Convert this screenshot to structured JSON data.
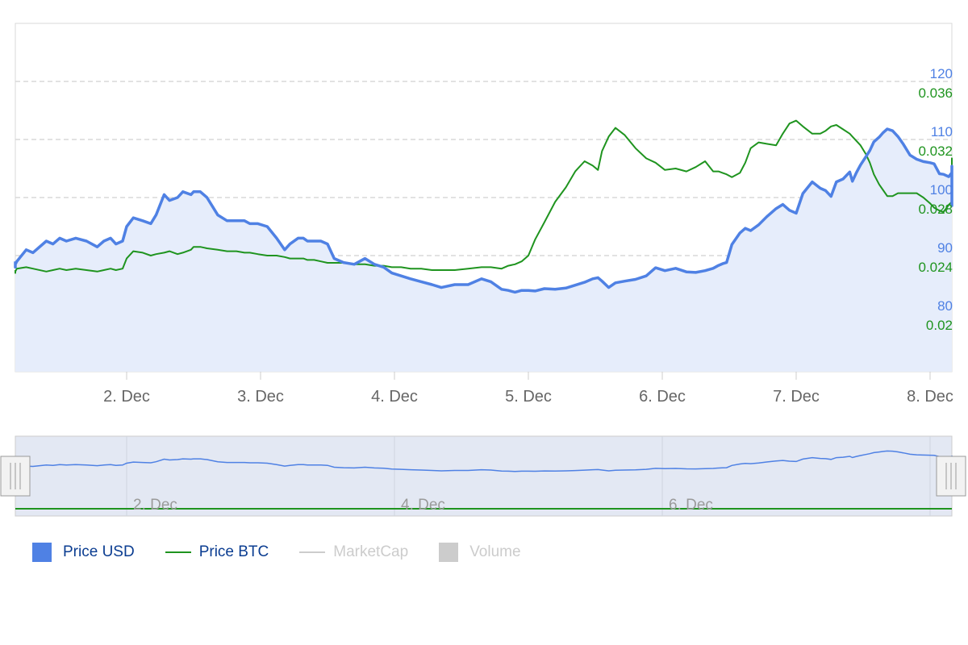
{
  "colors": {
    "usd": "#4f81e4",
    "usd_fill": "#e6edfb",
    "btc": "#1f941f",
    "grid": "#d8d8d8",
    "axis_label": "#666666",
    "navigator_fill": "#e3e8f3",
    "hidden": "#cccccc"
  },
  "chart_data": {
    "type": "line",
    "title": "",
    "x_start": "1. Dec 04:00",
    "x_end": "8. Dec 04:00",
    "xticks": [
      "2. Dec",
      "3. Dec",
      "4. Dec",
      "5. Dec",
      "6. Dec",
      "7. Dec",
      "8. Dec"
    ],
    "y_usd": {
      "ticks": [
        80,
        90,
        100,
        110,
        120
      ],
      "range": [
        70,
        130
      ]
    },
    "y_btc": {
      "ticks": [
        "0.02",
        "0.024",
        "0.028",
        "0.032",
        "0.036"
      ],
      "range": [
        0.016,
        0.04
      ]
    },
    "grid": true,
    "legend_position": "bottom-left",
    "series": [
      {
        "name": "Price USD",
        "axis": "usd",
        "x_days": [
          0.0,
          0.05,
          0.1,
          0.18,
          0.25,
          0.3,
          0.4,
          0.45,
          0.5,
          0.55,
          0.62,
          0.7,
          0.78,
          0.83,
          0.88,
          0.92,
          0.97,
          1.0,
          1.05,
          1.12,
          1.18,
          1.22,
          1.28,
          1.32,
          1.38,
          1.42,
          1.48,
          1.5,
          1.55,
          1.6,
          1.68,
          1.75,
          1.82,
          1.88,
          1.92,
          1.98,
          2.05,
          2.12,
          2.18,
          2.22,
          2.28,
          2.32,
          2.35,
          2.4,
          2.45,
          2.5,
          2.55,
          2.62,
          2.7,
          2.78,
          2.85,
          2.92,
          2.98,
          3.05,
          3.12,
          3.2,
          3.28,
          3.35,
          3.45,
          3.55,
          3.65,
          3.72,
          3.8,
          3.85,
          3.9,
          3.95,
          4.0,
          4.05,
          4.12,
          4.2,
          4.28,
          4.35,
          4.42,
          4.48,
          4.52,
          4.55,
          4.6,
          4.65,
          4.72,
          4.8,
          4.88,
          4.95,
          5.02,
          5.1,
          5.18,
          5.25,
          5.32,
          5.38,
          5.42,
          5.45,
          5.48,
          5.52,
          5.58,
          5.62,
          5.66,
          5.72,
          5.78,
          5.85,
          5.9,
          5.95,
          6.0,
          6.05,
          6.12,
          6.18,
          6.22,
          6.26,
          6.3,
          6.35,
          6.4,
          6.42,
          6.45,
          6.48,
          6.52,
          6.55,
          6.58,
          6.62,
          6.65,
          6.68,
          6.72,
          6.76,
          6.8,
          6.85,
          6.9,
          6.95,
          7.0,
          7.03,
          7.07,
          7.1,
          7.14,
          7.18,
          7.22,
          7.26,
          7.3,
          7.33,
          7.36,
          7.4,
          7.44,
          7.48,
          7.52,
          7.56,
          7.6,
          7.64,
          7.68,
          7.72,
          7.75,
          7.8,
          7.85,
          7.9,
          7.95,
          8.0
        ],
        "values": [
          89,
          88,
          88.5,
          89,
          91,
          90.5,
          92.5,
          92,
          93,
          92.5,
          93,
          92.5,
          91.5,
          92.5,
          93,
          92,
          92.5,
          95,
          96.5,
          96,
          95.5,
          97,
          100.5,
          99.5,
          100,
          101,
          100.5,
          101,
          101,
          100,
          97,
          96,
          96,
          96,
          95.5,
          95.5,
          95,
          93,
          91,
          92,
          93,
          93,
          92.5,
          92.5,
          92.5,
          92,
          89.5,
          88.8,
          88.5,
          89.5,
          88.5,
          88,
          87,
          86.5,
          86,
          85.5,
          85,
          84.5,
          85,
          85,
          86,
          85.5,
          84.2,
          84,
          83.7,
          84,
          84,
          83.9,
          84.3,
          84.2,
          84.4,
          84.9,
          85.4,
          86,
          86.2,
          85.6,
          84.5,
          85.3,
          85.6,
          85.9,
          86.5,
          87.9,
          87.4,
          87.8,
          87.2,
          87.1,
          87.4,
          87.8,
          88.3,
          88.6,
          88.8,
          91.9,
          93.9,
          94.7,
          94.3,
          95.3,
          96.7,
          98.1,
          98.8,
          97.8,
          97.3,
          100.7,
          102.7,
          101.6,
          101.2,
          100.2,
          102.7,
          103.2,
          104.4,
          102.8,
          104.3,
          105.6,
          107,
          108.1,
          109.6,
          110.4,
          111.2,
          111.8,
          111.5,
          110.5,
          109.2,
          107.3,
          106.6,
          106.2,
          106,
          105.8,
          104.1,
          104,
          103.6,
          104.3,
          104.1,
          104.6,
          105.4,
          105.1,
          104.6,
          104.3,
          104.6,
          104.8,
          104.2,
          103.8,
          102.9,
          102.2,
          101,
          99.5,
          98.6,
          100.7,
          101.7,
          102,
          101.5,
          101.8
        ]
      },
      {
        "name": "Price BTC",
        "axis": "btc",
        "x_days": [
          0.0,
          0.05,
          0.1,
          0.18,
          0.25,
          0.3,
          0.4,
          0.45,
          0.5,
          0.55,
          0.62,
          0.7,
          0.78,
          0.83,
          0.88,
          0.92,
          0.97,
          1.0,
          1.05,
          1.12,
          1.18,
          1.22,
          1.28,
          1.32,
          1.38,
          1.42,
          1.48,
          1.5,
          1.55,
          1.6,
          1.68,
          1.75,
          1.82,
          1.88,
          1.92,
          1.98,
          2.05,
          2.12,
          2.18,
          2.22,
          2.28,
          2.32,
          2.35,
          2.4,
          2.45,
          2.5,
          2.55,
          2.62,
          2.7,
          2.78,
          2.85,
          2.92,
          2.98,
          3.05,
          3.12,
          3.2,
          3.28,
          3.35,
          3.45,
          3.55,
          3.65,
          3.72,
          3.8,
          3.85,
          3.9,
          3.95,
          4.0,
          4.05,
          4.12,
          4.2,
          4.28,
          4.35,
          4.42,
          4.48,
          4.52,
          4.55,
          4.6,
          4.65,
          4.72,
          4.8,
          4.88,
          4.95,
          5.02,
          5.1,
          5.18,
          5.25,
          5.32,
          5.38,
          5.42,
          5.45,
          5.48,
          5.52,
          5.58,
          5.62,
          5.66,
          5.72,
          5.78,
          5.85,
          5.9,
          5.95,
          6.0,
          6.05,
          6.12,
          6.18,
          6.22,
          6.26,
          6.3,
          6.35,
          6.4,
          6.42,
          6.45,
          6.48,
          6.52,
          6.55,
          6.58,
          6.62,
          6.65,
          6.68,
          6.72,
          6.76,
          6.8,
          6.85,
          6.9,
          6.95,
          7.0,
          7.03,
          7.07,
          7.1,
          7.14,
          7.18,
          7.22,
          7.26,
          7.3,
          7.33,
          7.36,
          7.4,
          7.44,
          7.48,
          7.52,
          7.56,
          7.6,
          7.64,
          7.68,
          7.72,
          7.75,
          7.8,
          7.85,
          7.9,
          7.95,
          8.0
        ],
        "values": [
          0.023,
          0.0228,
          0.0229,
          0.0231,
          0.0232,
          0.0231,
          0.0229,
          0.023,
          0.0231,
          0.023,
          0.0231,
          0.023,
          0.0229,
          0.023,
          0.0231,
          0.023,
          0.0231,
          0.0238,
          0.0243,
          0.0242,
          0.024,
          0.0241,
          0.0242,
          0.0243,
          0.0241,
          0.0242,
          0.0244,
          0.0246,
          0.0246,
          0.0245,
          0.0244,
          0.0243,
          0.0243,
          0.0242,
          0.0242,
          0.0241,
          0.024,
          0.024,
          0.0239,
          0.0238,
          0.0238,
          0.0238,
          0.0237,
          0.0237,
          0.0236,
          0.0235,
          0.0235,
          0.0235,
          0.0234,
          0.0234,
          0.0233,
          0.0233,
          0.0232,
          0.0232,
          0.0231,
          0.0231,
          0.023,
          0.023,
          0.023,
          0.0231,
          0.0232,
          0.0232,
          0.0231,
          0.0233,
          0.0234,
          0.0236,
          0.024,
          0.0251,
          0.0263,
          0.0277,
          0.0287,
          0.0298,
          0.0305,
          0.0302,
          0.0299,
          0.0312,
          0.0322,
          0.0328,
          0.0323,
          0.0314,
          0.0307,
          0.0304,
          0.0299,
          0.03,
          0.0298,
          0.0301,
          0.0305,
          0.0298,
          0.0298,
          0.0297,
          0.0296,
          0.0294,
          0.0297,
          0.0304,
          0.0314,
          0.0318,
          0.0317,
          0.0316,
          0.0324,
          0.0331,
          0.0333,
          0.0329,
          0.0324,
          0.0324,
          0.0326,
          0.0329,
          0.033,
          0.0327,
          0.0324,
          0.0322,
          0.0319,
          0.0316,
          0.031,
          0.0304,
          0.0296,
          0.0289,
          0.0285,
          0.0281,
          0.0281,
          0.0283,
          0.0283,
          0.0283,
          0.0283,
          0.028,
          0.0276,
          0.0273,
          0.0271,
          0.027,
          0.0275,
          0.0277,
          0.0279,
          0.028,
          0.0282,
          0.0284,
          0.0288,
          0.0291,
          0.0292,
          0.0295,
          0.0297,
          0.0303,
          0.0307,
          0.0307,
          0.0305,
          0.0303,
          0.0298,
          0.0294,
          0.0297,
          0.0302,
          0.0301,
          0.0303,
          0.0304,
          0.0302
        ]
      }
    ]
  },
  "navigator": {
    "xticks": [
      "2. Dec",
      "4. Dec",
      "6. Dec"
    ]
  },
  "legend": {
    "items": [
      {
        "label": "Price USD",
        "symbol": "box",
        "state": "active"
      },
      {
        "label": "Price BTC",
        "symbol": "line",
        "state": "active"
      },
      {
        "label": "MarketCap",
        "symbol": "line",
        "state": "hidden"
      },
      {
        "label": "Volume",
        "symbol": "box",
        "state": "hidden"
      }
    ]
  }
}
